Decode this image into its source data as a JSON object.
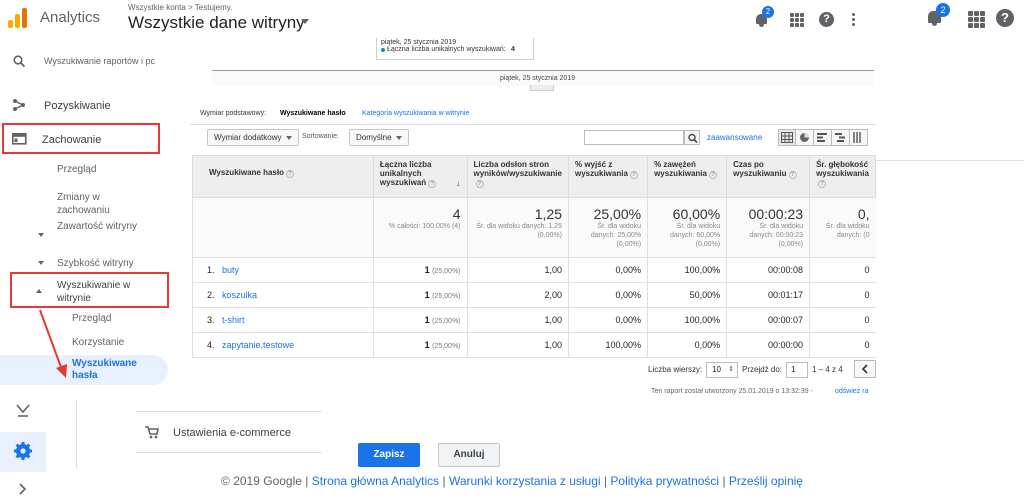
{
  "header": {
    "app_name": "Analytics",
    "breadcrumb": "Wszystkie konta > Testujemy.",
    "property": "Wszystkie dane witryny",
    "notifications_count": "2",
    "notifications_count_right": "2"
  },
  "sidebar": {
    "search_placeholder": "Wyszukiwanie raportów i pc",
    "acquisition": "Pozyskiwanie",
    "behavior": "Zachowanie",
    "items": {
      "overview": "Przegląd",
      "behavior_flow": "Zmiany w zachowaniu",
      "site_content": "Zawartość witryny",
      "site_speed": "Szybkość witryny",
      "site_search": "Wyszukiwanie w witrynie",
      "search_overview": "Przegląd",
      "usage": "Korzystanie",
      "search_terms": "Wyszukiwane hasła"
    }
  },
  "chart": {
    "tooltip_date": "piątek, 25 stycznia 2019",
    "tooltip_metric": "Łączna liczba unikalnych wyszukiwań:",
    "tooltip_value": "4",
    "x_label": "piątek, 25 stycznia 2019"
  },
  "dims": {
    "primary_label": "Wymiar podstawowy:",
    "primary_value": "Wyszukiwane hasło",
    "alt_link": "Kategoria wyszukiwania w witrynie",
    "secondary": "Wymiar dodatkowy",
    "sort_label": "Sortowanie:",
    "sort_value": "Domyślne",
    "advanced": "zaawansowane"
  },
  "table": {
    "headers": [
      "Wyszukiwane hasło",
      "Łączna liczba unikalnych wyszukiwań",
      "Liczba odsłon stron wyników/wyszukiwanie",
      "% wyjść z wyszukiwania",
      "% zawężeń wyszukiwania",
      "Czas po wyszukiwaniu",
      "Śr. głębokość wyszukiwania"
    ],
    "totals": [
      {
        "big": "4",
        "sub": "% całości: 100,00% (4)"
      },
      {
        "big": "1,25",
        "sub": "Śr. dla widoku danych: 1,25 (0,00%)"
      },
      {
        "big": "25,00%",
        "sub": "Śr. dla widoku danych: 25,00% (0,00%)"
      },
      {
        "big": "60,00%",
        "sub": "Śr. dla widoku danych: 60,00% (0,00%)"
      },
      {
        "big": "00:00:23",
        "sub": "Śr. dla widoku danych: 00:00:23 (0,00%)"
      },
      {
        "big": "0,",
        "sub": "Śr. dla widoku danych: (0"
      }
    ],
    "rows": [
      {
        "n": "1.",
        "term": "buty",
        "uniq": "1",
        "uniq_pct": "(25,00%)",
        "views": "1,00",
        "exits": "0,00%",
        "ref": "100,00%",
        "time": "00:00:08",
        "depth": "0"
      },
      {
        "n": "2.",
        "term": "koszulka",
        "uniq": "1",
        "uniq_pct": "(25,00%)",
        "views": "2,00",
        "exits": "0,00%",
        "ref": "50,00%",
        "time": "00:01:17",
        "depth": "0"
      },
      {
        "n": "3.",
        "term": "t-shirt",
        "uniq": "1",
        "uniq_pct": "(25,00%)",
        "views": "1,00",
        "exits": "0,00%",
        "ref": "100,00%",
        "time": "00:00:07",
        "depth": "0"
      },
      {
        "n": "4.",
        "term": "zapytanie,testowe",
        "uniq": "1",
        "uniq_pct": "(25,00%)",
        "views": "1,00",
        "exits": "100,00%",
        "ref": "0,00%",
        "time": "00:00:00",
        "depth": "0"
      }
    ]
  },
  "pager": {
    "rows_label": "Liczba wierszy:",
    "rows_value": "10",
    "goto_label": "Przejdź do:",
    "goto_value": "1",
    "range": "1 – 4 z 4"
  },
  "generated": "Ten raport został utworzony 25.01.2019 o 13:32:39 -",
  "refresh_link": "odśwież ra",
  "ecommerce": "Ustawienia e-commerce",
  "buttons": {
    "save": "Zapisz",
    "cancel": "Anuluj"
  },
  "footer": {
    "copyright": "© 2019 Google |",
    "home": "Strona główna Analytics",
    "terms": "Warunki korzystania z usługi",
    "privacy": "Polityka prywatności",
    "feedback": "Prześlij opinię",
    "sep": "|"
  },
  "colors": {
    "accent": "#1a73e8",
    "annotation": "#e53935",
    "selected_bg": "#e8f0fe"
  }
}
